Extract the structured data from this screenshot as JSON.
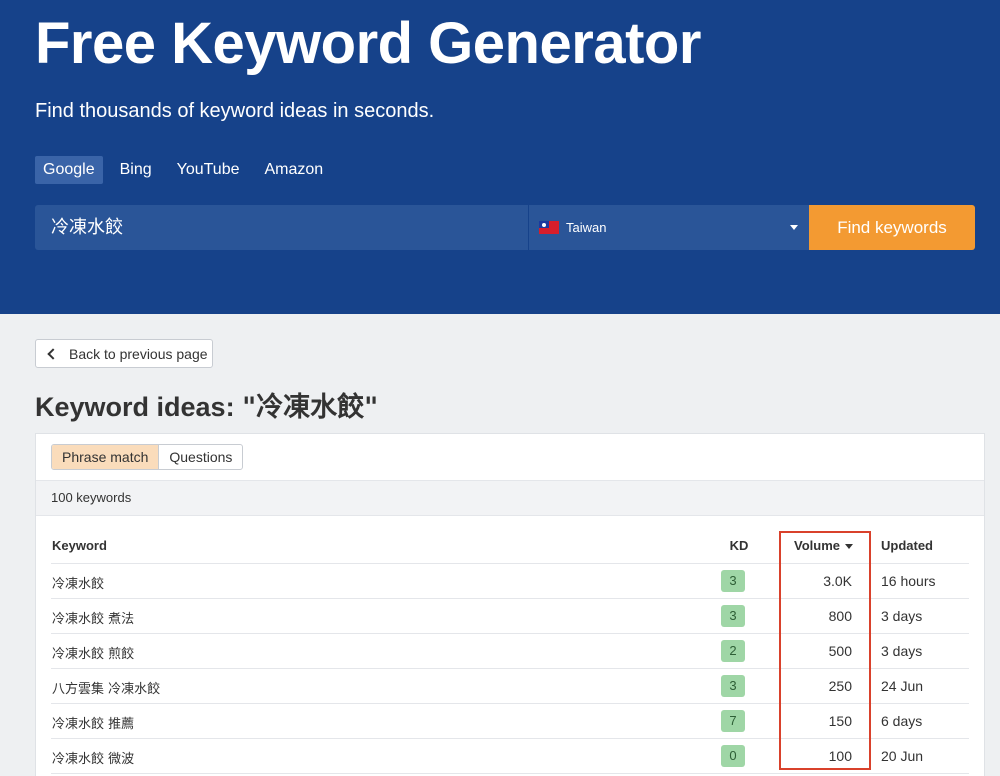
{
  "hero": {
    "title": "Free Keyword Generator",
    "subtitle": "Find thousands of keyword ideas in seconds."
  },
  "engines": [
    {
      "label": "Google",
      "active": true
    },
    {
      "label": "Bing",
      "active": false
    },
    {
      "label": "YouTube",
      "active": false
    },
    {
      "label": "Amazon",
      "active": false
    }
  ],
  "search": {
    "query": "冷凍水餃",
    "country": "Taiwan",
    "country_flag_icon": "taiwan-flag-icon",
    "submit_label": "Find keywords",
    "submit_color": "#f39a32"
  },
  "back_label": "Back to previous page",
  "results": {
    "title_prefix": "Keyword ideas: ",
    "title_query": "\"冷凍水餃\"",
    "match_tabs": [
      {
        "label": "Phrase match",
        "active": true
      },
      {
        "label": "Questions",
        "active": false
      }
    ],
    "count_label": "100 keywords",
    "columns": {
      "keyword": "Keyword",
      "kd": "KD",
      "volume": "Volume",
      "updated": "Updated"
    },
    "sort": {
      "column": "volume",
      "direction": "desc"
    },
    "rows": [
      {
        "keyword": "冷凍水餃",
        "kd": "3",
        "volume": "3.0K",
        "updated": "16 hours"
      },
      {
        "keyword": "冷凍水餃 煮法",
        "kd": "3",
        "volume": "800",
        "updated": "3 days"
      },
      {
        "keyword": "冷凍水餃 煎餃",
        "kd": "2",
        "volume": "500",
        "updated": "3 days"
      },
      {
        "keyword": "八方雲集 冷凍水餃",
        "kd": "3",
        "volume": "250",
        "updated": "24 Jun"
      },
      {
        "keyword": "冷凍水餃 推薦",
        "kd": "7",
        "volume": "150",
        "updated": "6 days"
      },
      {
        "keyword": "冷凍水餃 微波",
        "kd": "0",
        "volume": "100",
        "updated": "20 Jun"
      }
    ]
  },
  "colors": {
    "hero_bg": "#16428a",
    "active_tab_bg": "#3a64a8",
    "kd_badge_bg": "#9fd6a6",
    "highlight_border": "#d9412b",
    "phrase_tab_bg": "#fadcbb"
  }
}
